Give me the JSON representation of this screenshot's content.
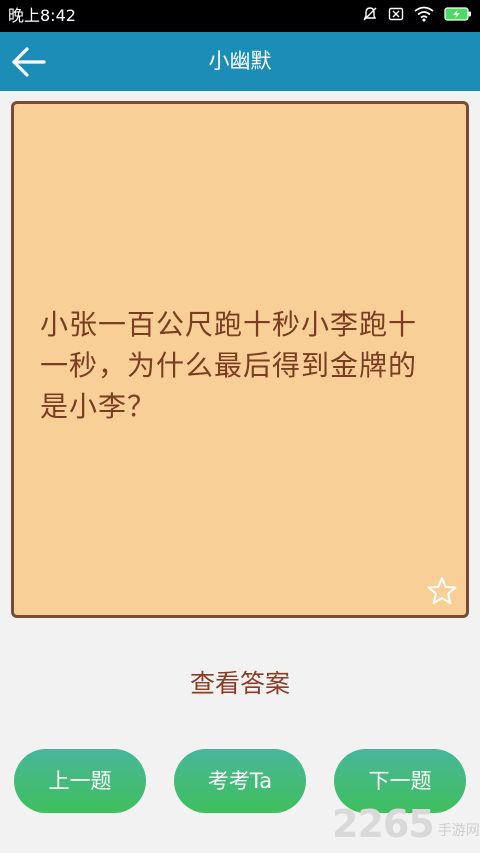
{
  "status_bar": {
    "time": "晚上8:42",
    "icons": [
      "mute-bell-icon",
      "sim-x-icon",
      "wifi-icon",
      "battery-charging-icon"
    ]
  },
  "app_bar": {
    "back_icon": "arrow-left-icon",
    "title": "小幽默"
  },
  "card": {
    "question": "小张一百公尺跑十秒小李跑十一秒，为什么最后得到金牌的是小李？",
    "favorite_icon": "star-outline-icon",
    "background": "#f9cf98",
    "border_color": "#7a4a32"
  },
  "answer_link": "查看答案",
  "buttons": {
    "prev": "上一题",
    "test": "考考Ta",
    "next": "下一题"
  },
  "watermark": {
    "logo": "2265",
    "suffix": "手游网"
  },
  "colors": {
    "app_bar": "#1b8db7",
    "button": "#44bb74",
    "text_brown": "#7a3d22"
  }
}
